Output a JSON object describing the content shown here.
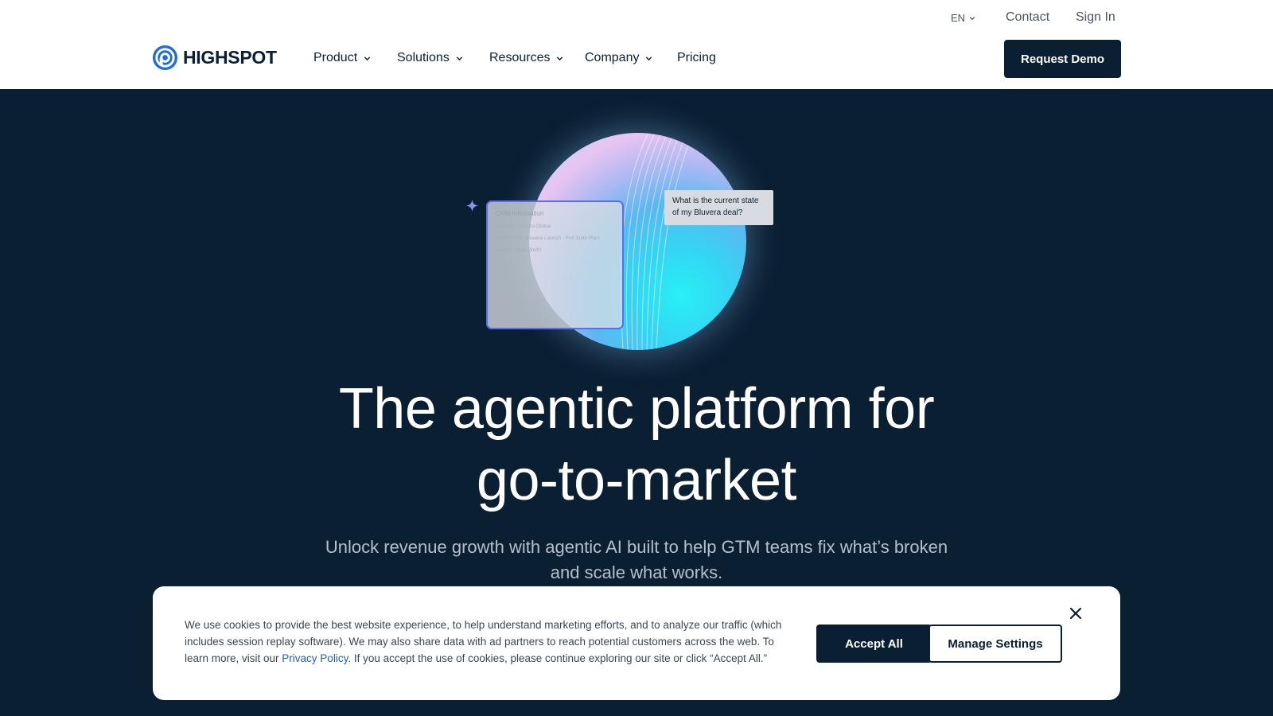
{
  "header": {
    "language": "EN",
    "utility_links": {
      "contact": "Contact",
      "sign_in": "Sign In"
    },
    "logo_text": "HIGHSPOT",
    "nav": {
      "product": "Product",
      "solutions": "Solutions",
      "resources": "Resources",
      "company": "Company",
      "pricing": "Pricing"
    },
    "cta": "Request Demo"
  },
  "hero": {
    "illustration": {
      "crm_card": {
        "title": "CRM Information",
        "rows": [
          "Account: Bluvera Global",
          "Opportunity: Bluvera Launch - Full Suite Plan",
          "Owner: Alexa Smith"
        ]
      },
      "question": "What is the current state of my Bluvera deal?"
    },
    "title_line1": "The agentic platform for",
    "title_line2": "go-to-market",
    "subtitle": "Unlock revenue growth with agentic AI built to help GTM teams fix what’s broken and scale what works."
  },
  "cookie_banner": {
    "text_before_link": "We use cookies to provide the best website experience, to help understand marketing efforts, and to analyze our traffic (which includes session replay software). We may also share data with ad partners to reach potential customers across the web. To learn more, visit our ",
    "link_text": "Privacy Policy",
    "text_after_link": ". If you accept the use of cookies, please continue exploring our site or click “Accept All.”",
    "accept_label": "Accept All",
    "manage_label": "Manage Settings"
  },
  "colors": {
    "navy": "#0b1f33",
    "link_blue": "#1f5fbf",
    "card_border": "#5b6cf2"
  },
  "icons": [
    "logo-mark-icon",
    "chevron-down-icon",
    "sparkle-icon",
    "close-icon"
  ]
}
